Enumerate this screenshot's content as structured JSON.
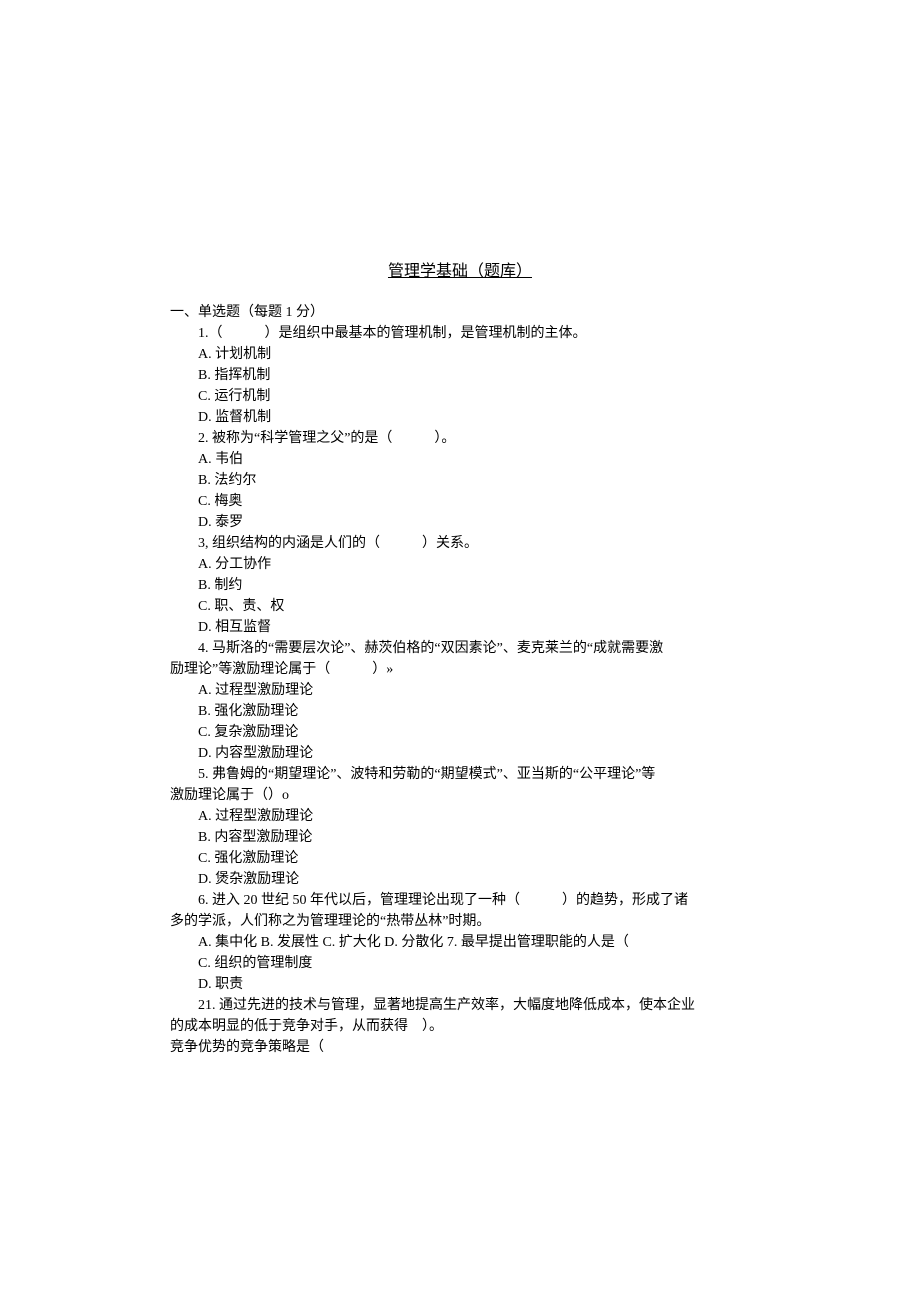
{
  "title": "管理学基础（题库）",
  "section": "一、单选题（每题 1 分）",
  "lines": {
    "q1": "1.（　　　）是组织中最基本的管理机制，是管理机制的主体。",
    "q1A": "A. 计划机制",
    "q1B": "B. 指挥机制",
    "q1C": "C. 运行机制",
    "q1D": "D. 监督机制",
    "q2": "2. 被称为“科学管理之父”的是（　　　）。",
    "q2A": "A. 韦伯",
    "q2B": "B. 法约尔",
    "q2C": "C. 梅奥",
    "q2D": "D. 泰罗",
    "q3": "3, 组织结构的内涵是人们的（　　　）关系。",
    "q3A": "A. 分工协作",
    "q3B": "B. 制约",
    "q3C": "C. 职、责、权",
    "q3D": "D. 相互监督",
    "q4a": "4. 马斯洛的“需要层次论”、赫茨伯格的“双因素论”、麦克莱兰的“成就需要激",
    "q4b": "励理论”等激励理论属于（　　　）»",
    "q4A": "A. 过程型激励理论",
    "q4B": "B. 强化激励理论",
    "q4C": "C. 复杂激励理论",
    "q4D": "D. 内容型激励理论",
    "q5a": "5. 弗鲁姆的“期望理论”、波特和劳勒的“期望模式”、亚当斯的“公平理论”等",
    "q5b": "激励理论属于（）o",
    "q5A": "A. 过程型激励理论",
    "q5B": "B. 内容型激励理论",
    "q5C": "C. 强化激励理论",
    "q5D": "D. 煲杂激励理论",
    "q6a": "6. 进入 20 世纪 50 年代以后，管理理论出现了一种（　　　）的趋势，形成了诸",
    "q6b": "多的学派，人们称之为管理理论的“热带丛林”时期。",
    "q6opts": "A. 集中化 B. 发展性 C. 扩大化 D. 分散化 7. 最早提出管理职能的人是（",
    "q7C": "C. 组织的管理制度",
    "q7D": "D. 职责",
    "q21a": "21. 通过先进的技术与管理，显著地提高生产效率，大幅度地降低成本，使本企业",
    "q21b": "的成本明显的低于竞争对手，从而获得　）。",
    "q21c": "竞争优势的竞争策略是（"
  }
}
